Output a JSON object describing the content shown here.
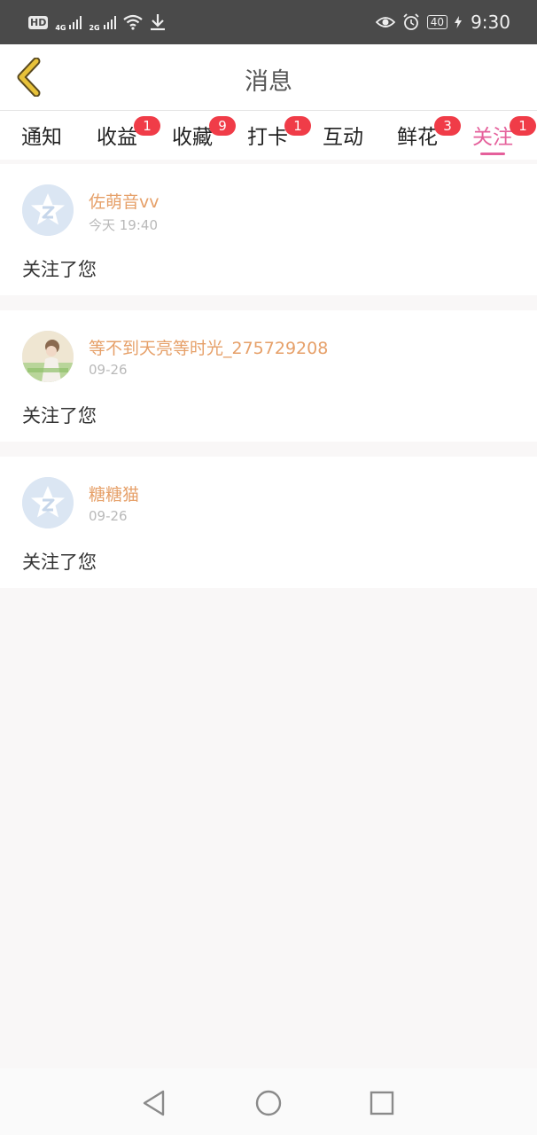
{
  "status_bar": {
    "hd": "HD",
    "net1": "4G",
    "net2": "2G",
    "battery": "40",
    "time": "9:30"
  },
  "header": {
    "title": "消息"
  },
  "tabs": [
    {
      "label": "通知",
      "badge": ""
    },
    {
      "label": "收益",
      "badge": "1"
    },
    {
      "label": "收藏",
      "badge": "9"
    },
    {
      "label": "打卡",
      "badge": "1"
    },
    {
      "label": "互动",
      "badge": ""
    },
    {
      "label": "鲜花",
      "badge": "3"
    },
    {
      "label": "关注",
      "badge": "1"
    }
  ],
  "active_tab": "关注",
  "messages": [
    {
      "user": "佐萌音vv",
      "time": "今天 19:40",
      "text": "关注了您",
      "avatar": "default-avatar-icon"
    },
    {
      "user": "等不到天亮等时光_275729208",
      "time": "09-26",
      "text": "关注了您",
      "avatar": "photo-avatar"
    },
    {
      "user": "糖糖猫",
      "time": "09-26",
      "text": "关注了您",
      "avatar": "default-avatar-icon"
    }
  ],
  "colors": {
    "accent": "#e5609b",
    "badge": "#f03c48",
    "username": "#e6a069",
    "back_arrow": "#e8c23a"
  }
}
